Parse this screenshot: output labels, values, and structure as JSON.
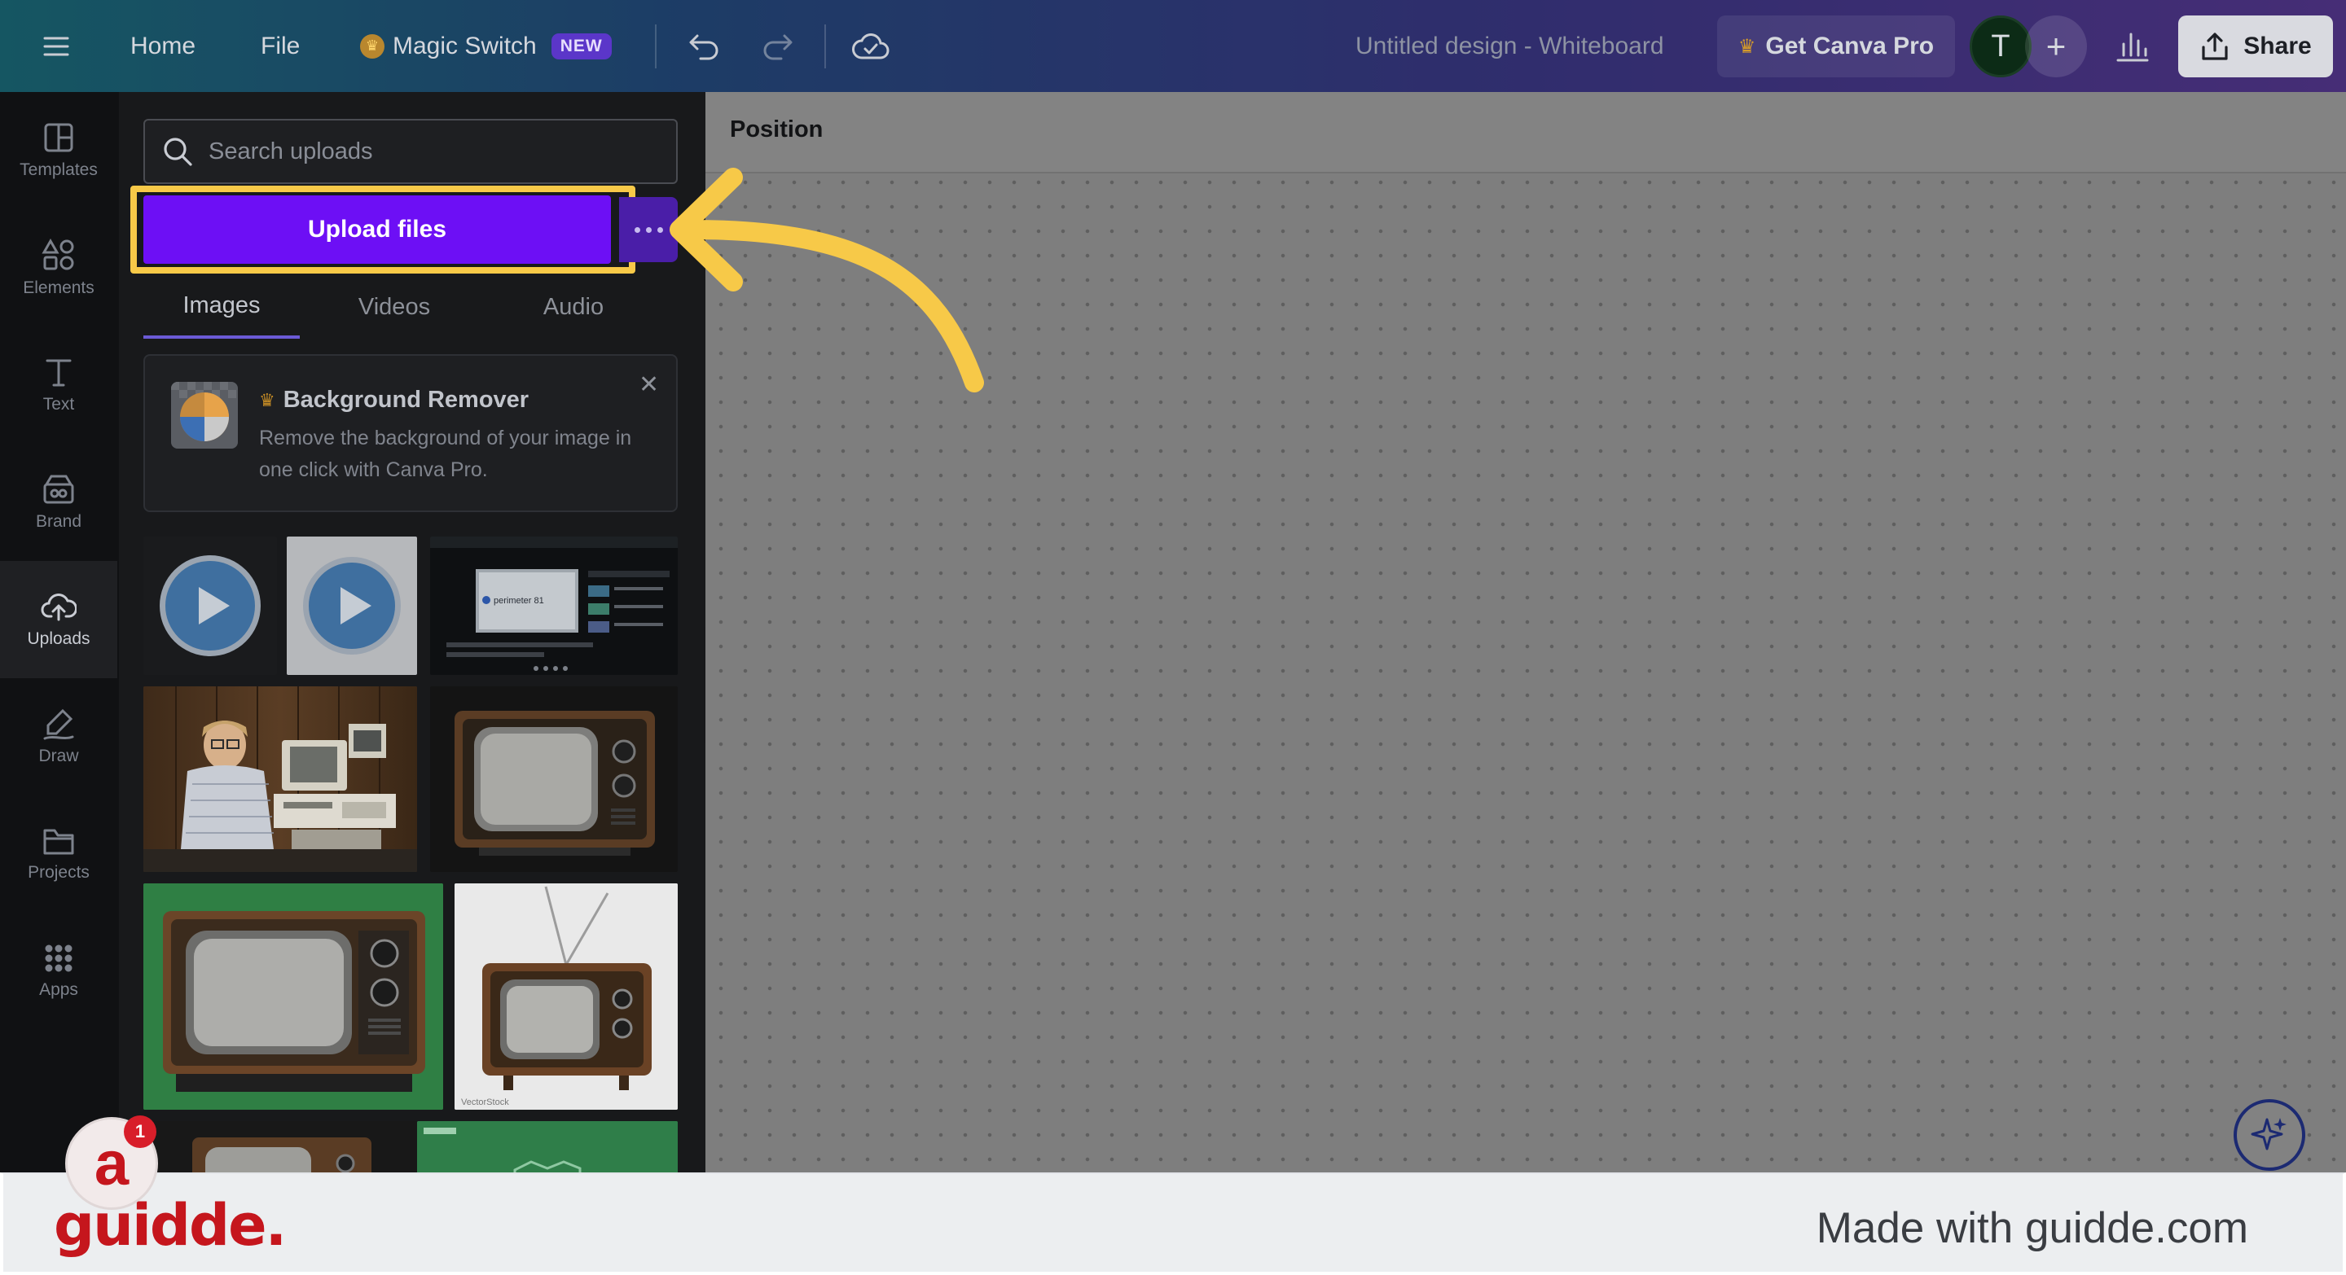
{
  "topbar": {
    "home": "Home",
    "file": "File",
    "magic_switch": "Magic Switch",
    "new_badge": "NEW",
    "doc_title": "Untitled design - Whiteboard",
    "get_pro": "Get Canva Pro",
    "avatar_letter": "T",
    "share": "Share"
  },
  "rail": {
    "items": [
      {
        "label": "Templates",
        "icon": "templates-icon"
      },
      {
        "label": "Elements",
        "icon": "elements-icon"
      },
      {
        "label": "Text",
        "icon": "text-icon"
      },
      {
        "label": "Brand",
        "icon": "brand-icon"
      },
      {
        "label": "Uploads",
        "icon": "upload-cloud-icon",
        "active": true
      },
      {
        "label": "Draw",
        "icon": "draw-icon"
      },
      {
        "label": "Projects",
        "icon": "folder-icon"
      },
      {
        "label": "Apps",
        "icon": "apps-grid-icon"
      }
    ]
  },
  "panel": {
    "search_placeholder": "Search uploads",
    "upload_button": "Upload files",
    "tabs": [
      {
        "label": "Images",
        "active": true
      },
      {
        "label": "Videos",
        "active": false
      },
      {
        "label": "Audio",
        "active": false
      }
    ],
    "promo": {
      "title": "Background Remover",
      "description": "Remove the background of your image in one click with Canva Pro."
    },
    "thumbnail_text": {
      "perimeter": "perimeter 81",
      "vectorstock": "VectorStock"
    }
  },
  "canvas": {
    "toolbar_label": "Position"
  },
  "footer": {
    "logo": "guidde.",
    "made_with": "Made with guidde.com",
    "badge_letter": "a",
    "notification_count": "1"
  },
  "colors": {
    "highlight": "#f7c948",
    "upload_button": "#6d0ff5",
    "guidde_red": "#c5161d"
  }
}
